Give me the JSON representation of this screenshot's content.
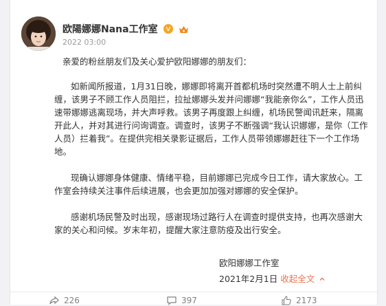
{
  "account": {
    "name": "欧陽娜娜Nana工作室",
    "time": "2022 03:00"
  },
  "post": {
    "greeting": "亲爱的粉丝朋友们及关心爱护欧阳娜娜的朋友们：",
    "paragraphs": [
      "如新闻所报道，1月31日晚，娜娜即将离开首都机场时突然遭不明人士上前纠缠，该男子不顾工作人员阻拦，拉扯娜娜头发并问娜娜“我能亲你么”，工作人员迅速带娜娜逃离现场，并大声呼救。该男子再度跟上纠缠，机场民警闻讯赶来，隔离开此人，并对其进行问询调查。调查时，该男子不断强调“我认识娜娜，是你（工作人员）拦着我”。在提供完相关录影证据后，工作人员带领娜娜赶往下一个工作场地。",
      "现确认娜娜身体健康、情绪平稳，目前娜娜已完成今日工作，请大家放心。工作室会持续关注事件后续进展，也会更加加强对娜娜的安全保护。",
      "感谢机场民警及时出现，感谢现场过路行人在调查时提供支持，也再次感谢大家的关心和问候。岁末年初，提醒大家注意防疫及出行安全。"
    ],
    "signature": "欧阳娜娜工作室",
    "date": "2021年2月1日",
    "collapse_label": "收起全文"
  },
  "actions": {
    "share_count": "226",
    "comment_count": "397",
    "like_count": "2173"
  },
  "colors": {
    "link": "#eb7350",
    "verified": "#f5a623"
  }
}
